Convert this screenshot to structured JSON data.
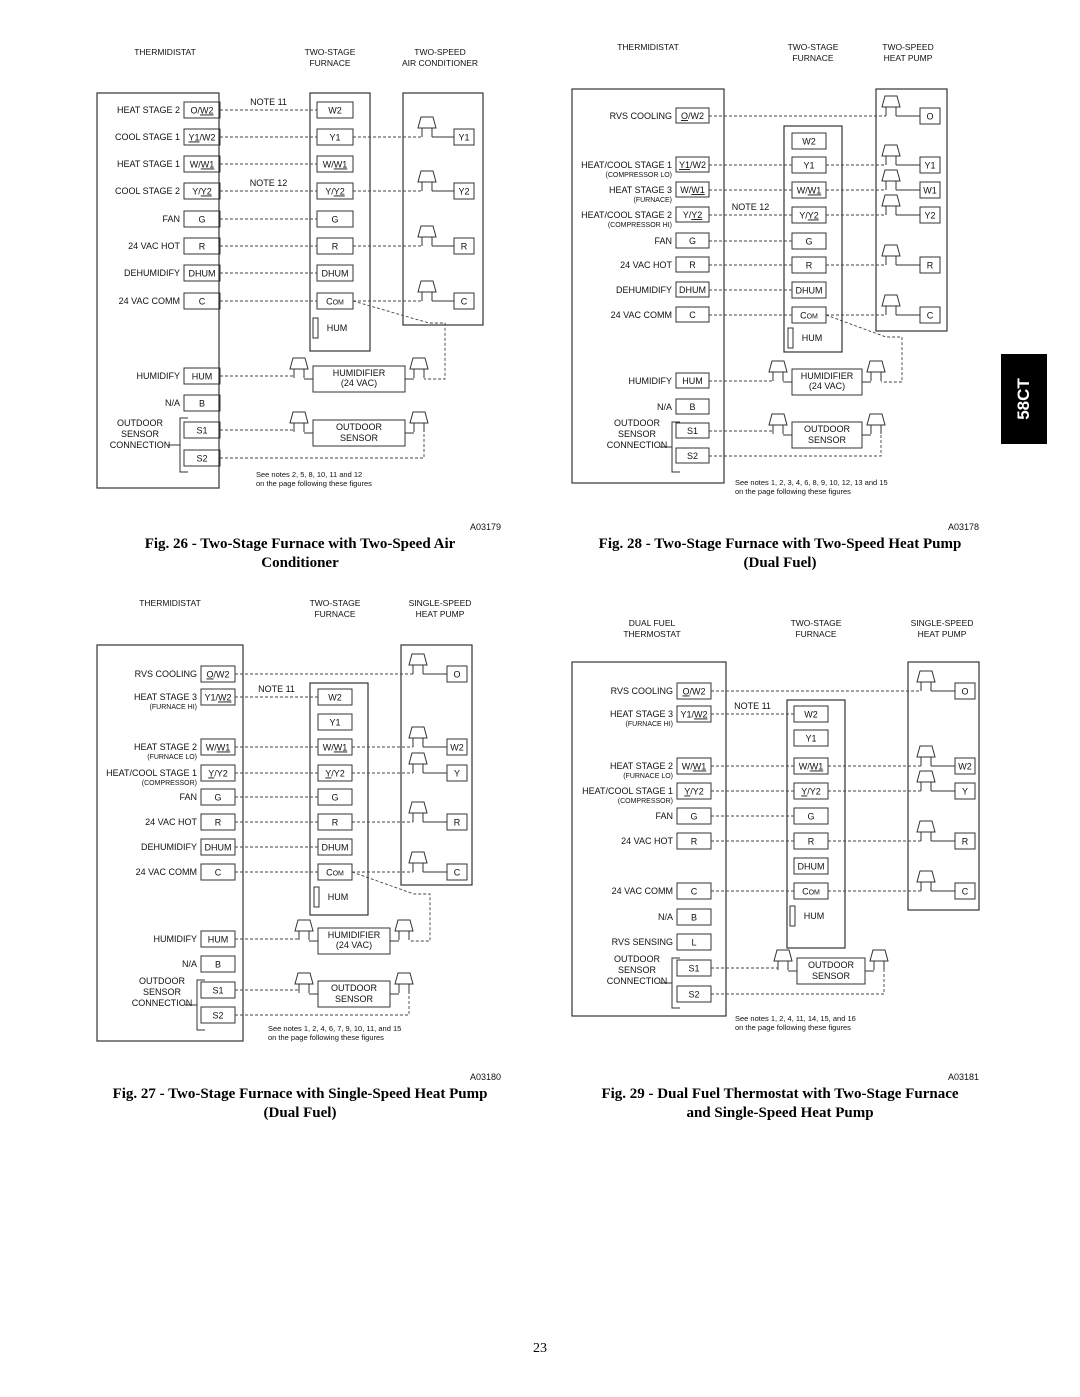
{
  "side_tab": "58CT",
  "page_number": "23",
  "figures": [
    {
      "id": "fig26",
      "figure_id": "A03179",
      "caption_line1": "Fig. 26 - Two-Stage Furnace with Two-Speed Air",
      "caption_line2": "Conditioner",
      "headers": {
        "thermostat": [
          "THERMIDISTAT"
        ],
        "furnace": [
          "TWO-STAGE",
          "FURNACE"
        ],
        "outdoor": [
          "TWO-SPEED",
          "AIR CONDITIONER"
        ]
      },
      "thermostat_terminals": [
        {
          "label": "HEAT STAGE 2",
          "sub": "",
          "terminal": "O/W2",
          "underline": "W2",
          "note": "NOTE 11",
          "to_furnace": "W2",
          "to_outdoor": ""
        },
        {
          "label": "COOL STAGE 1",
          "sub": "",
          "terminal": "Y1/W2",
          "underline": "Y1",
          "note": "",
          "to_furnace": "Y1",
          "to_outdoor": "Y1"
        },
        {
          "label": "HEAT STAGE 1",
          "sub": "",
          "terminal": "W/W1",
          "underline": "W1",
          "note": "",
          "to_furnace": "W/W1",
          "to_outdoor": ""
        },
        {
          "label": "COOL STAGE 2",
          "sub": "",
          "terminal": "Y/Y2",
          "underline": "Y2",
          "note": "NOTE 12",
          "to_furnace": "Y/Y2",
          "to_outdoor": "Y2"
        },
        {
          "label": "FAN",
          "sub": "",
          "terminal": "G",
          "underline": "",
          "note": "",
          "to_furnace": "G",
          "to_outdoor": ""
        },
        {
          "label": "24 VAC HOT",
          "sub": "",
          "terminal": "R",
          "underline": "",
          "note": "",
          "to_furnace": "R",
          "to_outdoor": "R"
        },
        {
          "label": "DEHUMIDIFY",
          "sub": "",
          "terminal": "DHUM",
          "underline": "",
          "note": "",
          "to_furnace": "DHUM",
          "to_outdoor": ""
        },
        {
          "label": "24 VAC COMM",
          "sub": "",
          "terminal": "C",
          "underline": "",
          "note": "",
          "to_furnace": "COM",
          "to_outdoor": "C"
        },
        {
          "label": "HUMIDIFY",
          "sub": "",
          "terminal": "HUM",
          "underline": "",
          "note": "",
          "to_furnace": "",
          "to_outdoor": ""
        },
        {
          "label": "N/A",
          "sub": "",
          "terminal": "B",
          "underline": "",
          "note": "",
          "to_furnace": "",
          "to_outdoor": ""
        },
        {
          "label": "",
          "sub": "",
          "terminal": "S1",
          "underline": "",
          "note": "",
          "to_furnace": "",
          "to_outdoor": ""
        },
        {
          "label": "",
          "sub": "",
          "terminal": "S2",
          "underline": "",
          "note": "",
          "to_furnace": "",
          "to_outdoor": ""
        }
      ],
      "furnace_terminals": [
        "W2",
        "Y1",
        "W/W1",
        "Y/Y2",
        "G",
        "R",
        "DHUM",
        "COM"
      ],
      "furnace_hum": "HUM",
      "humidifier": [
        "HUMIDIFIER",
        "(24 VAC)"
      ],
      "outdoor_sensor": [
        "OUTDOOR",
        "SENSOR"
      ],
      "outdoor_sensor_label": [
        "OUTDOOR",
        "SENSOR",
        "CONNECTION"
      ],
      "notes": [
        "See notes 2, 5, 8, 10, 11 and 12",
        "on the page following these figures"
      ]
    },
    {
      "id": "fig28",
      "figure_id": "A03178",
      "caption_line1": "Fig. 28 - Two-Stage Furnace with Two-Speed Heat Pump",
      "caption_line2": "(Dual Fuel)",
      "headers": {
        "thermostat": [
          "THERMIDISTAT"
        ],
        "furnace": [
          "TWO-STAGE",
          "FURNACE"
        ],
        "outdoor": [
          "TWO-SPEED",
          "HEAT PUMP"
        ]
      },
      "thermostat_terminals": [
        {
          "label": "RVS COOLING",
          "sub": "",
          "terminal": "O/W2",
          "underline": "O",
          "note": "",
          "to_furnace": "",
          "to_outdoor": "O"
        },
        {
          "label": "HEAT/COOL STAGE 1",
          "sub": "(COMPRESSOR LO)",
          "terminal": "Y1/W2",
          "underline": "Y1",
          "note": "",
          "to_furnace": "Y1",
          "to_outdoor": "Y1"
        },
        {
          "label": "HEAT STAGE 3",
          "sub": "(FURNACE)",
          "terminal": "W/W1",
          "underline": "W1",
          "note": "",
          "to_furnace": "W/W1",
          "to_outdoor": "W1"
        },
        {
          "label": "HEAT/COOL STAGE 2",
          "sub": "(COMPRESSOR HI)",
          "terminal": "Y/Y2",
          "underline": "Y2",
          "note": "NOTE 12",
          "to_furnace": "Y/Y2",
          "to_outdoor": "Y2"
        },
        {
          "label": "FAN",
          "sub": "",
          "terminal": "G",
          "underline": "",
          "note": "",
          "to_furnace": "G",
          "to_outdoor": ""
        },
        {
          "label": "24 VAC HOT",
          "sub": "",
          "terminal": "R",
          "underline": "",
          "note": "",
          "to_furnace": "R",
          "to_outdoor": "R"
        },
        {
          "label": "DEHUMIDIFY",
          "sub": "",
          "terminal": "DHUM",
          "underline": "",
          "note": "",
          "to_furnace": "DHUM",
          "to_outdoor": ""
        },
        {
          "label": "24 VAC COMM",
          "sub": "",
          "terminal": "C",
          "underline": "",
          "note": "",
          "to_furnace": "COM",
          "to_outdoor": "C"
        },
        {
          "label": "HUMIDIFY",
          "sub": "",
          "terminal": "HUM",
          "underline": "",
          "note": "",
          "to_furnace": "",
          "to_outdoor": ""
        },
        {
          "label": "N/A",
          "sub": "",
          "terminal": "B",
          "underline": "",
          "note": "",
          "to_furnace": "",
          "to_outdoor": ""
        },
        {
          "label": "",
          "sub": "",
          "terminal": "S1",
          "underline": "",
          "note": "",
          "to_furnace": "",
          "to_outdoor": ""
        },
        {
          "label": "",
          "sub": "",
          "terminal": "S2",
          "underline": "",
          "note": "",
          "to_furnace": "",
          "to_outdoor": ""
        }
      ],
      "furnace_terminals": [
        "W2",
        "Y1",
        "W/W1",
        "Y/Y2",
        "G",
        "R",
        "DHUM",
        "COM"
      ],
      "furnace_hum": "HUM",
      "humidifier": [
        "HUMIDIFIER",
        "(24 VAC)"
      ],
      "outdoor_sensor": [
        "OUTDOOR",
        "SENSOR"
      ],
      "outdoor_sensor_label": [
        "OUTDOOR",
        "SENSOR",
        "CONNECTION"
      ],
      "notes": [
        "See notes 1, 2, 3, 4, 6, 8, 9, 10, 12, 13 and 15",
        "on the page following these figures"
      ]
    },
    {
      "id": "fig27",
      "figure_id": "A03180",
      "caption_line1": "Fig. 27 - Two-Stage Furnace with Single-Speed Heat Pump",
      "caption_line2": "(Dual Fuel)",
      "headers": {
        "thermostat": [
          "THERMIDISTAT"
        ],
        "furnace": [
          "TWO-STAGE",
          "FURNACE"
        ],
        "outdoor": [
          "SINGLE-SPEED",
          "HEAT PUMP"
        ]
      },
      "thermostat_terminals": [
        {
          "label": "RVS COOLING",
          "sub": "",
          "terminal": "O/W2",
          "underline": "O",
          "note": "",
          "to_furnace": "",
          "to_outdoor": "O"
        },
        {
          "label": "HEAT STAGE 3",
          "sub": "(FURNACE HI)",
          "terminal": "Y1/W2",
          "underline": "W2",
          "note": "NOTE 11",
          "to_furnace": "W2",
          "to_outdoor": ""
        },
        {
          "label": "",
          "sub": "",
          "terminal": "",
          "underline": "",
          "note": "",
          "to_furnace": "Y1",
          "to_outdoor": ""
        },
        {
          "label": "HEAT STAGE 2",
          "sub": "(FURNACE LO)",
          "terminal": "W/W1",
          "underline": "W1",
          "note": "",
          "to_furnace": "W/W1",
          "to_outdoor": "W2"
        },
        {
          "label": "HEAT/COOL STAGE 1",
          "sub": "(COMPRESSOR)",
          "terminal": "Y/Y2",
          "underline": "Y",
          "note": "",
          "to_furnace": "Y/Y2",
          "to_outdoor": "Y"
        },
        {
          "label": "FAN",
          "sub": "",
          "terminal": "G",
          "underline": "",
          "note": "",
          "to_furnace": "G",
          "to_outdoor": ""
        },
        {
          "label": "24 VAC HOT",
          "sub": "",
          "terminal": "R",
          "underline": "",
          "note": "",
          "to_furnace": "R",
          "to_outdoor": "R"
        },
        {
          "label": "DEHUMIDIFY",
          "sub": "",
          "terminal": "DHUM",
          "underline": "",
          "note": "",
          "to_furnace": "DHUM",
          "to_outdoor": ""
        },
        {
          "label": "24 VAC COMM",
          "sub": "",
          "terminal": "C",
          "underline": "",
          "note": "",
          "to_furnace": "COM",
          "to_outdoor": "C"
        },
        {
          "label": "HUMIDIFY",
          "sub": "",
          "terminal": "HUM",
          "underline": "",
          "note": "",
          "to_furnace": "",
          "to_outdoor": ""
        },
        {
          "label": "N/A",
          "sub": "",
          "terminal": "B",
          "underline": "",
          "note": "",
          "to_furnace": "",
          "to_outdoor": ""
        },
        {
          "label": "",
          "sub": "",
          "terminal": "S1",
          "underline": "",
          "note": "",
          "to_furnace": "",
          "to_outdoor": ""
        },
        {
          "label": "",
          "sub": "",
          "terminal": "S2",
          "underline": "",
          "note": "",
          "to_furnace": "",
          "to_outdoor": ""
        }
      ],
      "furnace_terminals": [
        "W2",
        "Y1",
        "W/W1",
        "Y/Y2",
        "G",
        "R",
        "DHUM",
        "COM"
      ],
      "furnace_hum": "HUM",
      "humidifier": [
        "HUMIDIFIER",
        "(24 VAC)"
      ],
      "outdoor_sensor": [
        "OUTDOOR",
        "SENSOR"
      ],
      "outdoor_sensor_label": [
        "OUTDOOR",
        "SENSOR",
        "CONNECTION"
      ],
      "notes": [
        "See notes 1, 2, 4, 6, 7, 9, 10, 11, and 15",
        "on the page following these figures"
      ]
    },
    {
      "id": "fig29",
      "figure_id": "A03181",
      "caption_line1": "Fig. 29 - Dual Fuel Thermostat with Two-Stage Furnace",
      "caption_line2": "and Single-Speed Heat Pump",
      "headers": {
        "thermostat": [
          "DUAL FUEL",
          "THERMOSTAT"
        ],
        "furnace": [
          "TWO-STAGE",
          "FURNACE"
        ],
        "outdoor": [
          "SINGLE-SPEED",
          "HEAT PUMP"
        ]
      },
      "thermostat_terminals": [
        {
          "label": "RVS COOLING",
          "sub": "",
          "terminal": "O/W2",
          "underline": "O",
          "note": "",
          "to_furnace": "",
          "to_outdoor": "O"
        },
        {
          "label": "HEAT STAGE 3",
          "sub": "(FURNACE HI)",
          "terminal": "Y1/W2",
          "underline": "W2",
          "note": "NOTE 11",
          "to_furnace": "W2",
          "to_outdoor": ""
        },
        {
          "label": "",
          "sub": "",
          "terminal": "",
          "underline": "",
          "note": "",
          "to_furnace": "Y1",
          "to_outdoor": ""
        },
        {
          "label": "HEAT STAGE 2",
          "sub": "(FURNACE LO)",
          "terminal": "W/W1",
          "underline": "W1",
          "note": "",
          "to_furnace": "W/W1",
          "to_outdoor": "W2"
        },
        {
          "label": "HEAT/COOL STAGE 1",
          "sub": "(COMPRESSOR)",
          "terminal": "Y/Y2",
          "underline": "Y",
          "note": "",
          "to_furnace": "Y/Y2",
          "to_outdoor": "Y"
        },
        {
          "label": "FAN",
          "sub": "",
          "terminal": "G",
          "underline": "",
          "note": "",
          "to_furnace": "G",
          "to_outdoor": ""
        },
        {
          "label": "24 VAC HOT",
          "sub": "",
          "terminal": "R",
          "underline": "",
          "note": "",
          "to_furnace": "R",
          "to_outdoor": "R"
        },
        {
          "label": "",
          "sub": "",
          "terminal": "",
          "underline": "",
          "note": "",
          "to_furnace": "DHUM",
          "to_outdoor": ""
        },
        {
          "label": "24 VAC COMM",
          "sub": "",
          "terminal": "C",
          "underline": "",
          "note": "",
          "to_furnace": "COM",
          "to_outdoor": "C"
        },
        {
          "label": "N/A",
          "sub": "",
          "terminal": "B",
          "underline": "",
          "note": "",
          "to_furnace": "",
          "to_outdoor": ""
        },
        {
          "label": "RVS SENSING",
          "sub": "",
          "terminal": "L",
          "underline": "",
          "note": "",
          "to_furnace": "",
          "to_outdoor": ""
        },
        {
          "label": "",
          "sub": "",
          "terminal": "S1",
          "underline": "",
          "note": "",
          "to_furnace": "",
          "to_outdoor": ""
        },
        {
          "label": "",
          "sub": "",
          "terminal": "S2",
          "underline": "",
          "note": "",
          "to_furnace": "",
          "to_outdoor": ""
        }
      ],
      "furnace_terminals": [
        "W2",
        "Y1",
        "W/W1",
        "Y/Y2",
        "G",
        "R",
        "DHUM",
        "COM"
      ],
      "furnace_hum": "HUM",
      "humidifier": [],
      "outdoor_sensor": [
        "OUTDOOR",
        "SENSOR"
      ],
      "outdoor_sensor_label": [
        "OUTDOOR",
        "SENSOR",
        "CONNECTION"
      ],
      "notes": [
        "See notes 1, 2, 4, 11, 14, 15,  and 16",
        "on the page following these figures"
      ]
    }
  ]
}
